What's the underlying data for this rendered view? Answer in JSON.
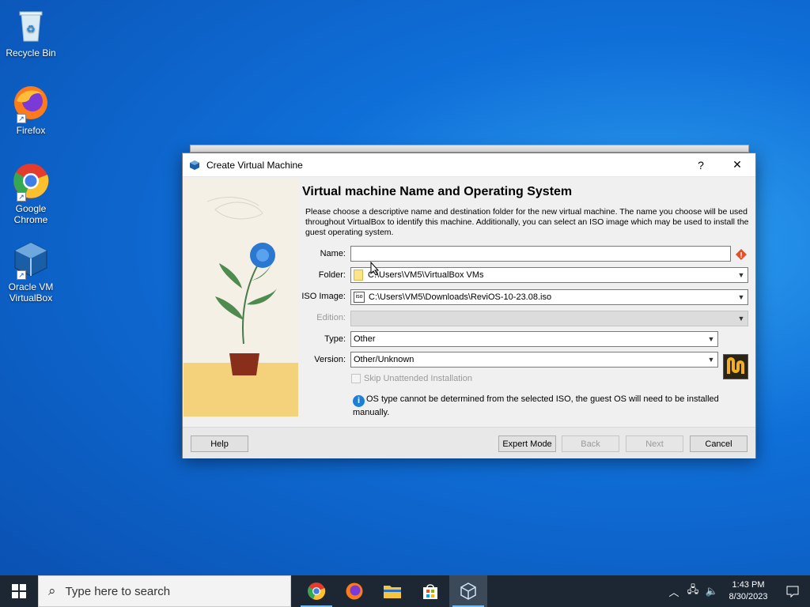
{
  "desktop": {
    "icons": [
      {
        "label": "Recycle Bin"
      },
      {
        "label": "Firefox"
      },
      {
        "label": "Google Chrome"
      },
      {
        "label": "Oracle VM VirtualBox"
      }
    ]
  },
  "dialog": {
    "title": "Create Virtual Machine",
    "help_glyph": "?",
    "close_glyph": "✕",
    "heading": "Virtual machine Name and Operating System",
    "description": "Please choose a descriptive name and destination folder for the new virtual machine. The name you choose will be used throughout VirtualBox to identify this machine. Additionally, you can select an ISO image which may be used to install the guest operating system.",
    "fields": {
      "name_label": "Name:",
      "name_value": "",
      "folder_label": "Folder:",
      "folder_value": "C:\\Users\\VM5\\VirtualBox VMs",
      "iso_label": "ISO Image:",
      "iso_value": "C:\\Users\\VM5\\Downloads\\ReviOS-10-23.08.iso",
      "edition_label": "Edition:",
      "edition_value": "",
      "type_label": "Type:",
      "type_value": "Other",
      "version_label": "Version:",
      "version_value": "Other/Unknown",
      "skip_unattended_label": "Skip Unattended Installation",
      "skip_unattended_checked": false
    },
    "info_text": "OS type cannot be determined from the selected ISO, the guest OS will need to be installed manually.",
    "buttons": {
      "help": "Help",
      "expert_mode": "Expert Mode",
      "back": "Back",
      "next": "Next",
      "cancel": "Cancel"
    }
  },
  "taskbar": {
    "search_placeholder": "Type here to search",
    "time": "1:43 PM",
    "date": "8/30/2023"
  },
  "colors": {
    "accent": "#0a5fd0",
    "warning": "#e0502a",
    "info": "#1e7fd8"
  }
}
